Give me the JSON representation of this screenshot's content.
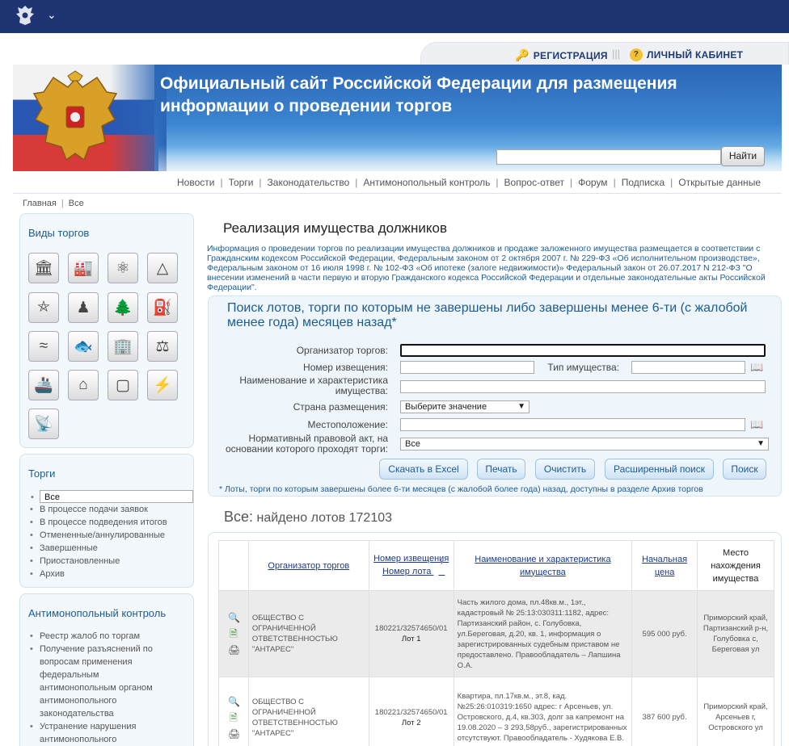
{
  "header": {
    "registration": "РЕГИСТРАЦИЯ",
    "cabinet": "ЛИЧНЫЙ КАБИНЕТ",
    "site_title": "Официальный сайт Российской Федерации для размещения информации о проведении торгов",
    "search_button": "Найти"
  },
  "nav": [
    "Новости",
    "Торги",
    "Законодательство",
    "Антимонопольный контроль",
    "Вопрос-ответ",
    "Форум",
    "Подписка",
    "Открытые данные"
  ],
  "breadcrumb": [
    "Главная",
    "Все"
  ],
  "sidebar": {
    "types_title": "Виды торгов",
    "icons": [
      "bank-icon",
      "factory-icon",
      "atom-icon",
      "drill-rig-icon",
      "crane-icon",
      "fisherman-icon",
      "forest-icon",
      "oil-pump-icon",
      "water-icon",
      "fish-icon",
      "building-icon",
      "scales-icon",
      "ship-icon",
      "house-icon",
      "billboard-icon",
      "power-tower-icon",
      "antenna-icon"
    ],
    "torgi_title": "Торги",
    "torgi_items": [
      "Все",
      "В процессе подачи заявок",
      "В процессе подведения итогов",
      "Отмененные/аннулированные",
      "Завершенные",
      "Приостановленные",
      "Архив"
    ],
    "anti_title": "Антимонопольный контроль",
    "anti_items": [
      "Реестр жалоб по торгам",
      "Получение разъяснений по вопросам применения федеральным антимонопольным органом антимонопольного законодательства",
      "Устранение нарушения антимонопольного"
    ]
  },
  "main": {
    "title": "Реализация имущества должников",
    "info": "Информация о проведении торгов по реализации имущества должников и продаже заложенного имущества размещается в соответствии с Гражданским кодексом Российской Федерации, Федеральным законом от 2 октября 2007 г. № 229-ФЗ «Об исполнительном производстве», Федеральным законом от 16 июля 1998 г. № 102-ФЗ «Об ипотеке (залоге недвижимости)» Федеральный закон от 26.07.2017 N 212-ФЗ \"О внесении изменений в части первую и вторую Гражданского кодекса Российской Федерации и отдельные законодательные акты Российской Федерации\"."
  },
  "search": {
    "title": "Поиск лотов, торги по которым не завершены либо завершены менее 6-ти (с жалобой менее года) месяцев назад*",
    "org_label": "Организатор торгов:",
    "notice_label": "Номер извещения:",
    "prop_type_label": "Тип имущества:",
    "name_label": "Наименование и характеристика имущества:",
    "country_label": "Страна размещения:",
    "country_value": "Выберите значение",
    "location_label": "Местоположение:",
    "act_label": "Нормативный правовой акт, на основании которого проходят торги:",
    "act_value": "Все",
    "buttons": [
      "Скачать в Excel",
      "Печать",
      "Очистить",
      "Расширенный поиск",
      "Поиск"
    ],
    "note": "* Лоты, торги по которым завершены более 6-ти месяцев (с жалобой более года) назад, доступны в разделе Архив торгов"
  },
  "found": {
    "label": "Все:",
    "text": "найдено лотов 172103"
  },
  "table": {
    "headers": [
      "Организатор торгов",
      "Номер извещения",
      "Номер лота",
      "Наименование и характеристика имущества",
      "Начальная цена",
      "Место нахождения имущества"
    ],
    "rows": [
      {
        "org": "ОБЩЕСТВО С ОГРАНИЧЕННОЙ ОТВЕТСТВЕННОСТЬЮ \"АНТАРЕС\"",
        "notice": "180221/32574650/01",
        "lot": "Лот 1",
        "desc": "Часть жилого дома, пл.48кв.м., 1эт., кадастровый № 25:13:030311:1182, адрес: Партизанский район, с. Голубовка, ул.Береговая, д.20, кв. 1, информация о зарегистрированных судебным приставом не предоставлено. Правообладатель – Лапшина О.А.",
        "price": "595 000 руб.",
        "place": "Приморский край, Партизанский р-н, Голубовка с, Береговая ул"
      },
      {
        "org": "ОБЩЕСТВО С ОГРАНИЧЕННОЙ ОТВЕТСТВЕННОСТЬЮ \"АНТАРЕС\"",
        "notice": "180221/32574650/01",
        "lot": "Лот 2",
        "desc": "Квартира, пл.17кв.м., эт.8, кад. №25:26:010319:1650 адрес: г Арсеньев, ул. Островского, д.4, кв.303, долг за капремонт на 19.08.2020 – 3 293,58руб., зарегистрированных отсутствуют. Правообладатель - Худякова Е.В.",
        "price": "387 600 руб.",
        "place": "Приморский край, Арсеньев г, Островского ул"
      }
    ]
  },
  "colors": {
    "topbar": "#1e3473",
    "link": "#1d5b95",
    "accent": "#3c85d0"
  }
}
